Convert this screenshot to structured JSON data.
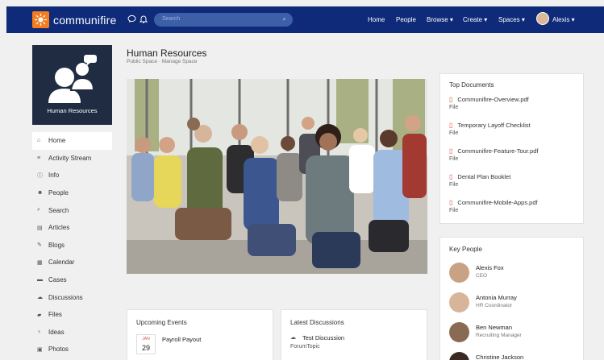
{
  "topbar": {
    "brand": "communifire",
    "search_placeholder": "Search",
    "nav": [
      "Home",
      "People",
      "Browse ▾",
      "Create ▾",
      "Spaces ▾"
    ],
    "user": "Alexis ▾"
  },
  "space": {
    "name": "Human Resources",
    "meta": "Public Space · Manage Space"
  },
  "sidebar": {
    "items": [
      {
        "icon": "home-icon",
        "glyph": "⌂",
        "label": "Home"
      },
      {
        "icon": "list-icon",
        "glyph": "≡",
        "label": "Activity Stream"
      },
      {
        "icon": "info-icon",
        "glyph": "ⓘ",
        "label": "Info"
      },
      {
        "icon": "people-icon",
        "glyph": "☻",
        "label": "People"
      },
      {
        "icon": "search-icon",
        "glyph": "⌕",
        "label": "Search"
      },
      {
        "icon": "article-icon",
        "glyph": "▤",
        "label": "Articles"
      },
      {
        "icon": "blog-icon",
        "glyph": "✎",
        "label": "Blogs"
      },
      {
        "icon": "calendar-icon",
        "glyph": "▦",
        "label": "Calendar"
      },
      {
        "icon": "cases-icon",
        "glyph": "▬",
        "label": "Cases"
      },
      {
        "icon": "discussion-icon",
        "glyph": "☁",
        "label": "Discussions"
      },
      {
        "icon": "folder-icon",
        "glyph": "▰",
        "label": "Files"
      },
      {
        "icon": "lightbulb-icon",
        "glyph": "♀",
        "label": "Ideas"
      },
      {
        "icon": "photo-icon",
        "glyph": "▣",
        "label": "Photos"
      }
    ]
  },
  "top_documents": {
    "title": "Top Documents",
    "items": [
      {
        "name": "Communifire-Overview.pdf",
        "type": "File"
      },
      {
        "name": "Temporary Layoff Checklist",
        "type": "File"
      },
      {
        "name": "Communifire-Feature-Tour.pdf",
        "type": "File"
      },
      {
        "name": "Dental Plan Booklet",
        "type": "File"
      },
      {
        "name": "Communifire-Mobile-Apps.pdf",
        "type": "File"
      }
    ]
  },
  "key_people": {
    "title": "Key People",
    "items": [
      {
        "name": "Alexis Fox",
        "role": "CEO",
        "color": "#c9a185"
      },
      {
        "name": "Antonia Murray",
        "role": "HR Coordinator",
        "color": "#d7b59a"
      },
      {
        "name": "Ben Newman",
        "role": "Recruiting Manager",
        "color": "#8a6a52"
      },
      {
        "name": "Christine Jackson",
        "role": "",
        "color": "#3a2a22"
      }
    ]
  },
  "upcoming_events": {
    "title": "Upcoming Events",
    "items": [
      {
        "month": "JAN",
        "day": "29",
        "name": "Payroll Payout"
      }
    ]
  },
  "latest_discussions": {
    "title": "Latest Discussions",
    "items": [
      {
        "title": "Test Discussion",
        "forum": "ForumTopic"
      }
    ]
  },
  "colors": {
    "topbar": "#0e2a78",
    "brand": "#f47d20",
    "pdf": "#d9534f"
  }
}
